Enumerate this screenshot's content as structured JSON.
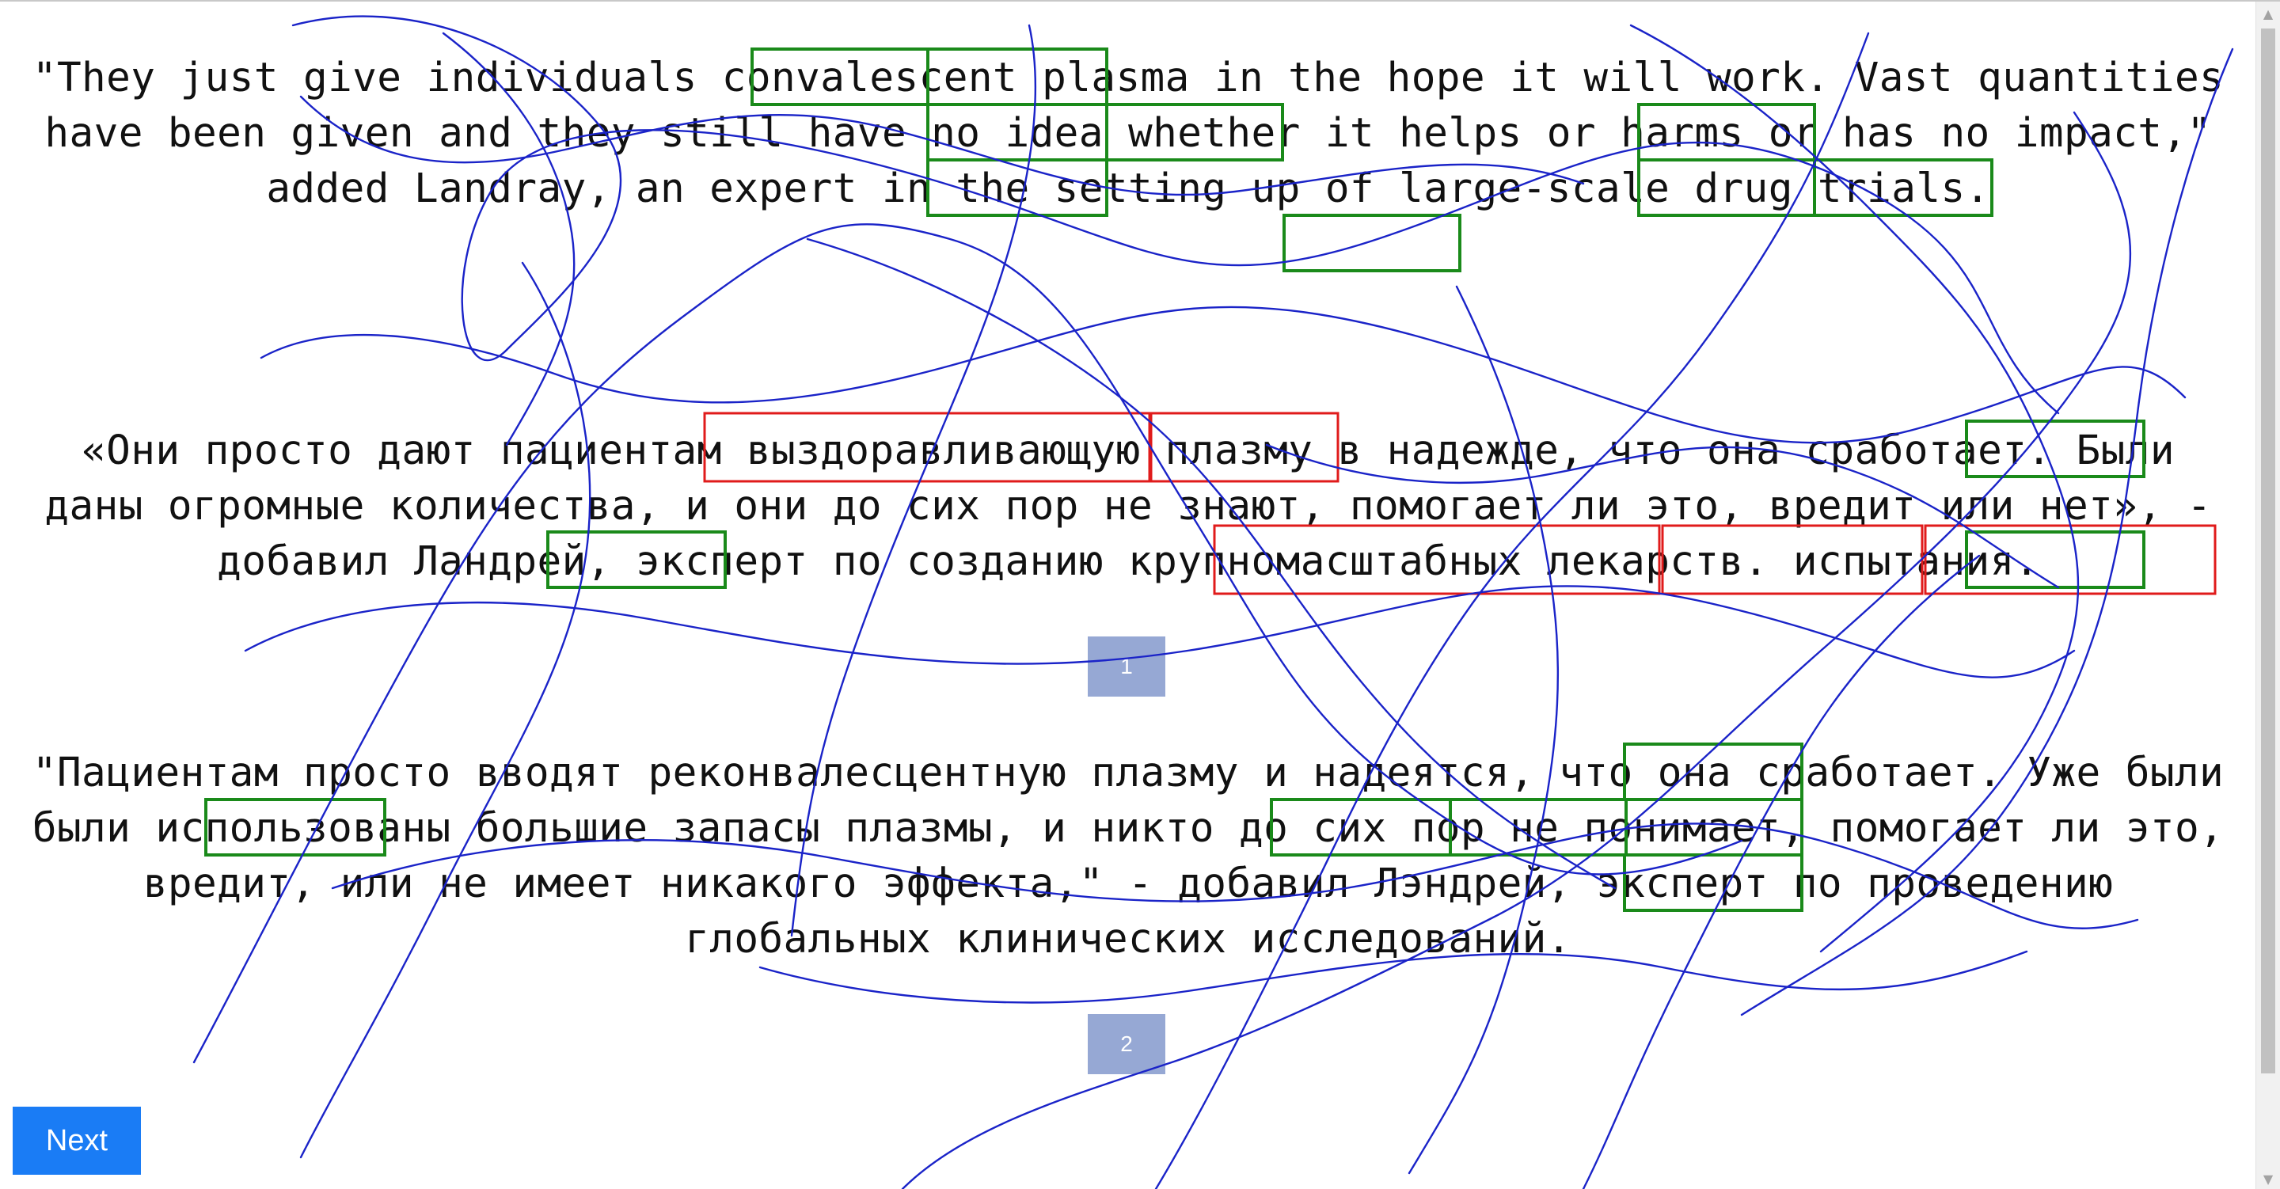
{
  "passages": {
    "english": "\"They just give individuals convalescent plasma in the hope it will work. Vast quantities have been given and they still have no idea whether it helps or harms or has no impact,\" added Landray, an expert in the setting up of large-scale drug trials.",
    "russian_1": "«Они просто дают пациентам выздоравливающую плазму в надежде, что она сработает. Были даны огромные количества, и они до сих пор не знают, помогает ли это, вредит или нет», - добавил Ландрей, эксперт по созданию крупномасштабных лекарств. испытания.",
    "russian_2": "\"Пациентам просто вводят реконвалесцентную плазму и надеятся, что она сработает. Уже были были использованы большие запасы плазмы, и никто до сих пор не понимает, помогает ли это, вредит, или не имеет никакого эффекта,\" - добавил Лэндрей, эксперт по проведению глобальных клинических исследований."
  },
  "badges": {
    "first": "1",
    "second": "2"
  },
  "next_button": {
    "label": "Next"
  },
  "colors": {
    "match_box": "#1a8a1a",
    "error_box": "#e01b1b",
    "scribble": "#1a23c8",
    "badge": "#96a8d4",
    "button": "#1a7cf5"
  }
}
